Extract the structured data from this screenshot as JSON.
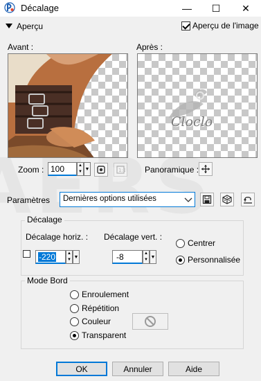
{
  "window": {
    "title": "Décalage",
    "minimize_glyph": "—",
    "maximize_glyph": "☐",
    "close_glyph": "✕"
  },
  "preview_section": {
    "toggle_label": "Aperçu",
    "preview_on_image_label": "Aperçu de l'image",
    "preview_on_image_checked": true,
    "before_label": "Avant :",
    "after_label": "Après :"
  },
  "zoom": {
    "label": "Zoom :",
    "value": "100",
    "pan_label": "Panoramique :"
  },
  "watermark_text": "Cloclo",
  "presets": {
    "label": "Paramètres",
    "selected": "Dernières options utilisées"
  },
  "offset": {
    "group_label": "Décalage",
    "horiz_label": "Décalage horiz. :",
    "horiz_value": "-220",
    "vert_label": "Décalage vert. :",
    "vert_value": "-8",
    "link_checked": false,
    "center_label": "Centrer",
    "custom_label": "Personnalisée",
    "selected": "custom"
  },
  "edge_mode": {
    "group_label": "Mode Bord",
    "options": [
      "Enroulement",
      "Répétition",
      "Couleur",
      "Transparent"
    ],
    "selected": "Transparent"
  },
  "buttons": {
    "ok": "OK",
    "cancel": "Annuler",
    "help": "Aide"
  },
  "colors": {
    "accent": "#0078d7",
    "window_bg": "#f0f0f0"
  },
  "background_watermark": "AERS"
}
